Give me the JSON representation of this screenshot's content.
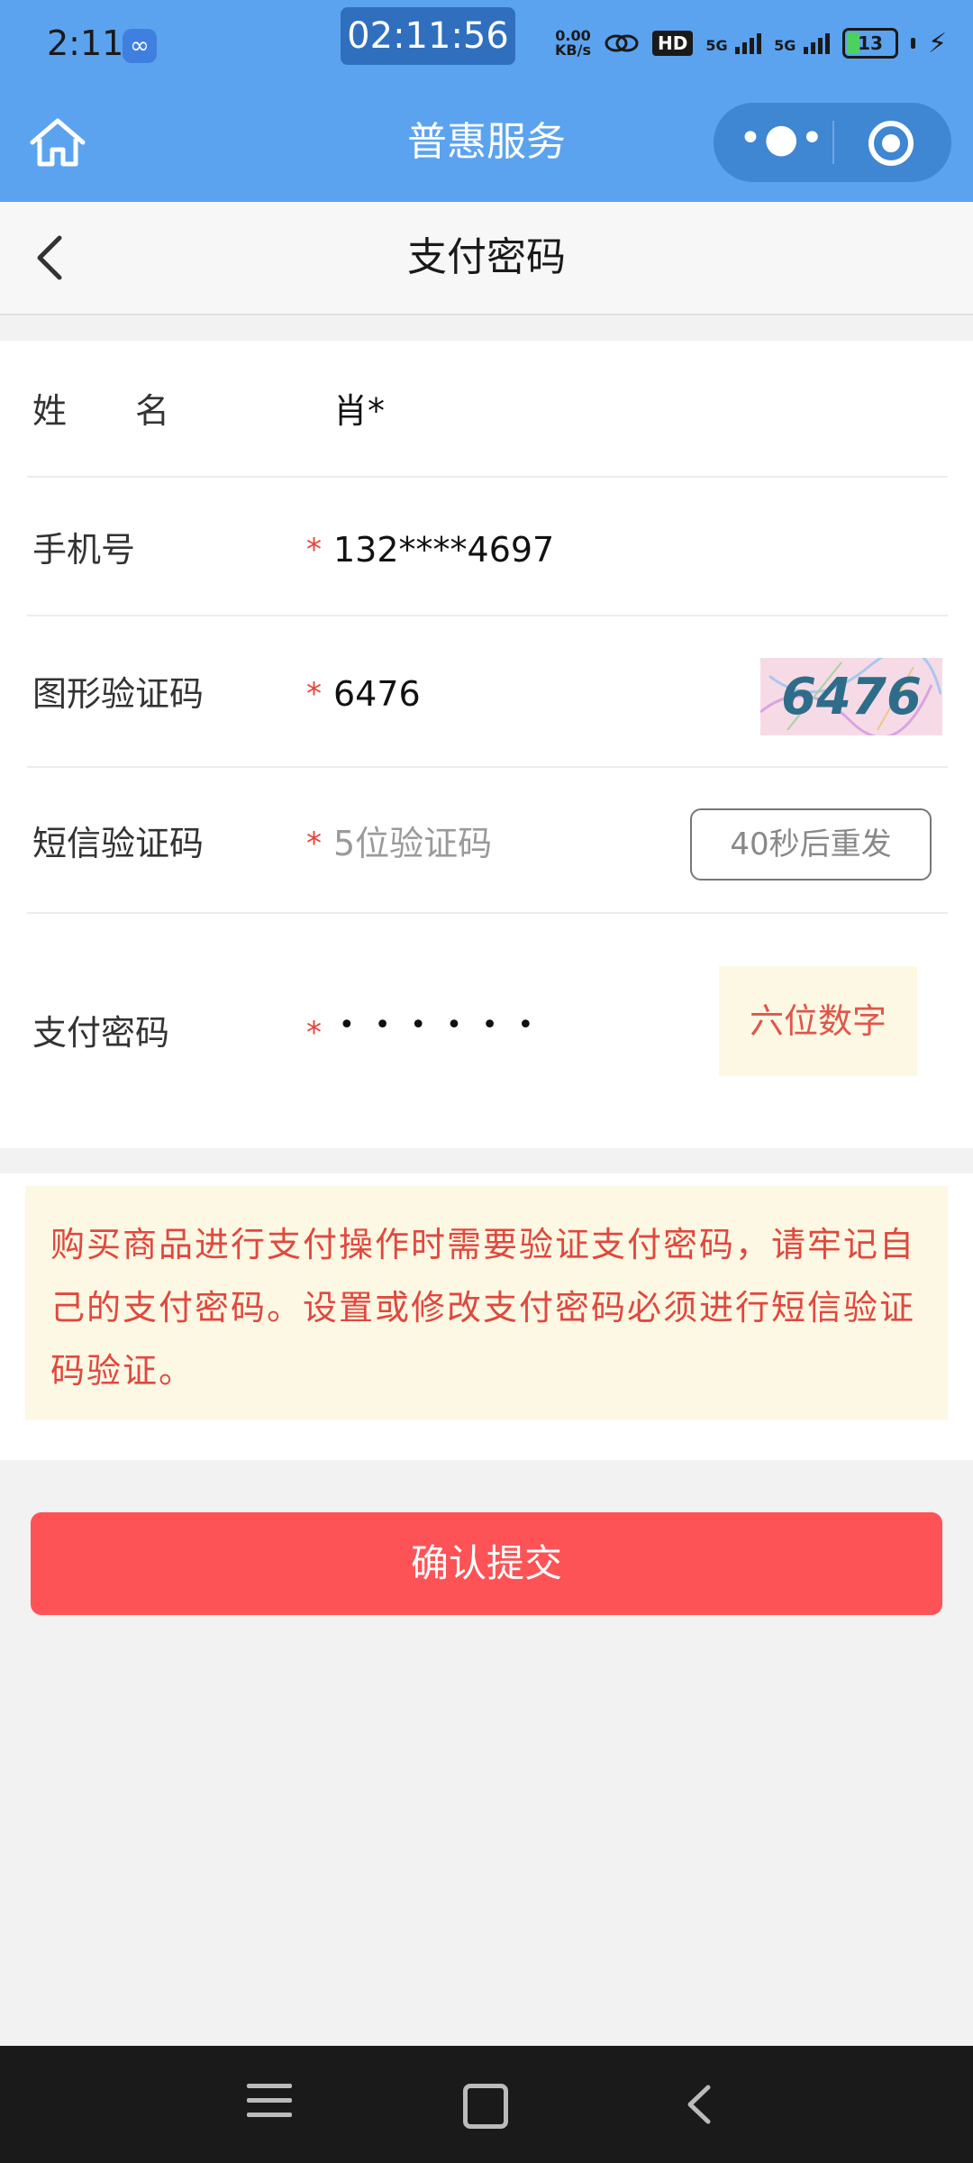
{
  "status_bar": {
    "time": "2:11",
    "timer": "02:11:56",
    "net_speed_value": "0.00",
    "net_speed_unit": "KB/s",
    "hd_label": "HD",
    "signal1_label": "5G",
    "signal2_label": "5G",
    "battery_level": "13",
    "battery_color": "#4cd15c"
  },
  "mini_program": {
    "title": "普惠服务",
    "more_label": "•●•"
  },
  "page": {
    "title": "支付密码"
  },
  "form": {
    "name": {
      "label": "姓　　名",
      "value": "肖*"
    },
    "phone": {
      "label": "手机号",
      "required_mark": "*",
      "value": "132****4697"
    },
    "captcha": {
      "label": "图形验证码",
      "required_mark": "*",
      "value": "6476",
      "image_text": "6476"
    },
    "sms": {
      "label": "短信验证码",
      "required_mark": "*",
      "placeholder": "5位验证码",
      "resend_label": "40秒后重发"
    },
    "password": {
      "label": "支付密码",
      "required_mark": "*",
      "masked_value": "••••••",
      "hint": "六位数字"
    }
  },
  "notice": {
    "text": "购买商品进行支付操作时需要验证支付密码，请牢记自己的支付密码。设置或修改支付密码必须进行短信验证码验证。"
  },
  "submit": {
    "label": "确认提交",
    "color": "#fd5356"
  },
  "colors": {
    "header_blue": "#5ba3ef",
    "required_red": "#e8423a",
    "notice_bg": "#fdf8e4"
  }
}
